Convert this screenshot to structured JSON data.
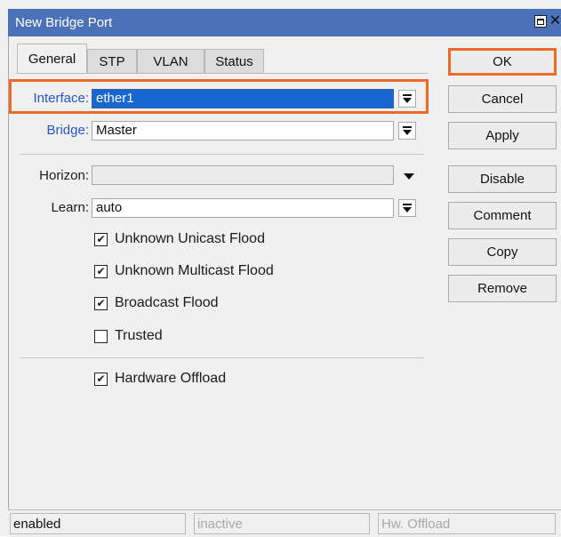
{
  "window": {
    "title": "New Bridge Port"
  },
  "tabs": [
    {
      "label": "General",
      "active": true
    },
    {
      "label": "STP",
      "active": false
    },
    {
      "label": "VLAN",
      "active": false
    },
    {
      "label": "Status",
      "active": false
    }
  ],
  "fields": {
    "interface": {
      "label": "Interface:",
      "value": "ether1"
    },
    "bridge": {
      "label": "Bridge:",
      "value": "Master"
    },
    "horizon": {
      "label": "Horizon:",
      "value": ""
    },
    "learn": {
      "label": "Learn:",
      "value": "auto"
    }
  },
  "checkboxes": [
    {
      "label": "Unknown Unicast Flood",
      "checked": true
    },
    {
      "label": "Unknown Multicast Flood",
      "checked": true
    },
    {
      "label": "Broadcast Flood",
      "checked": true
    },
    {
      "label": "Trusted",
      "checked": false
    },
    {
      "label": "Hardware Offload",
      "checked": true
    }
  ],
  "buttons": {
    "ok": "OK",
    "cancel": "Cancel",
    "apply": "Apply",
    "disable": "Disable",
    "comment": "Comment",
    "copy": "Copy",
    "remove": "Remove"
  },
  "status": {
    "state": "enabled",
    "running": "inactive",
    "hw": "Hw. Offload"
  },
  "colors": {
    "titlebar": "#4b72b8",
    "highlight": "#ee6a2b",
    "selection": "#1667cf",
    "label_blue": "#2455d6"
  },
  "icons": {
    "check": "✔",
    "close": "✕"
  }
}
